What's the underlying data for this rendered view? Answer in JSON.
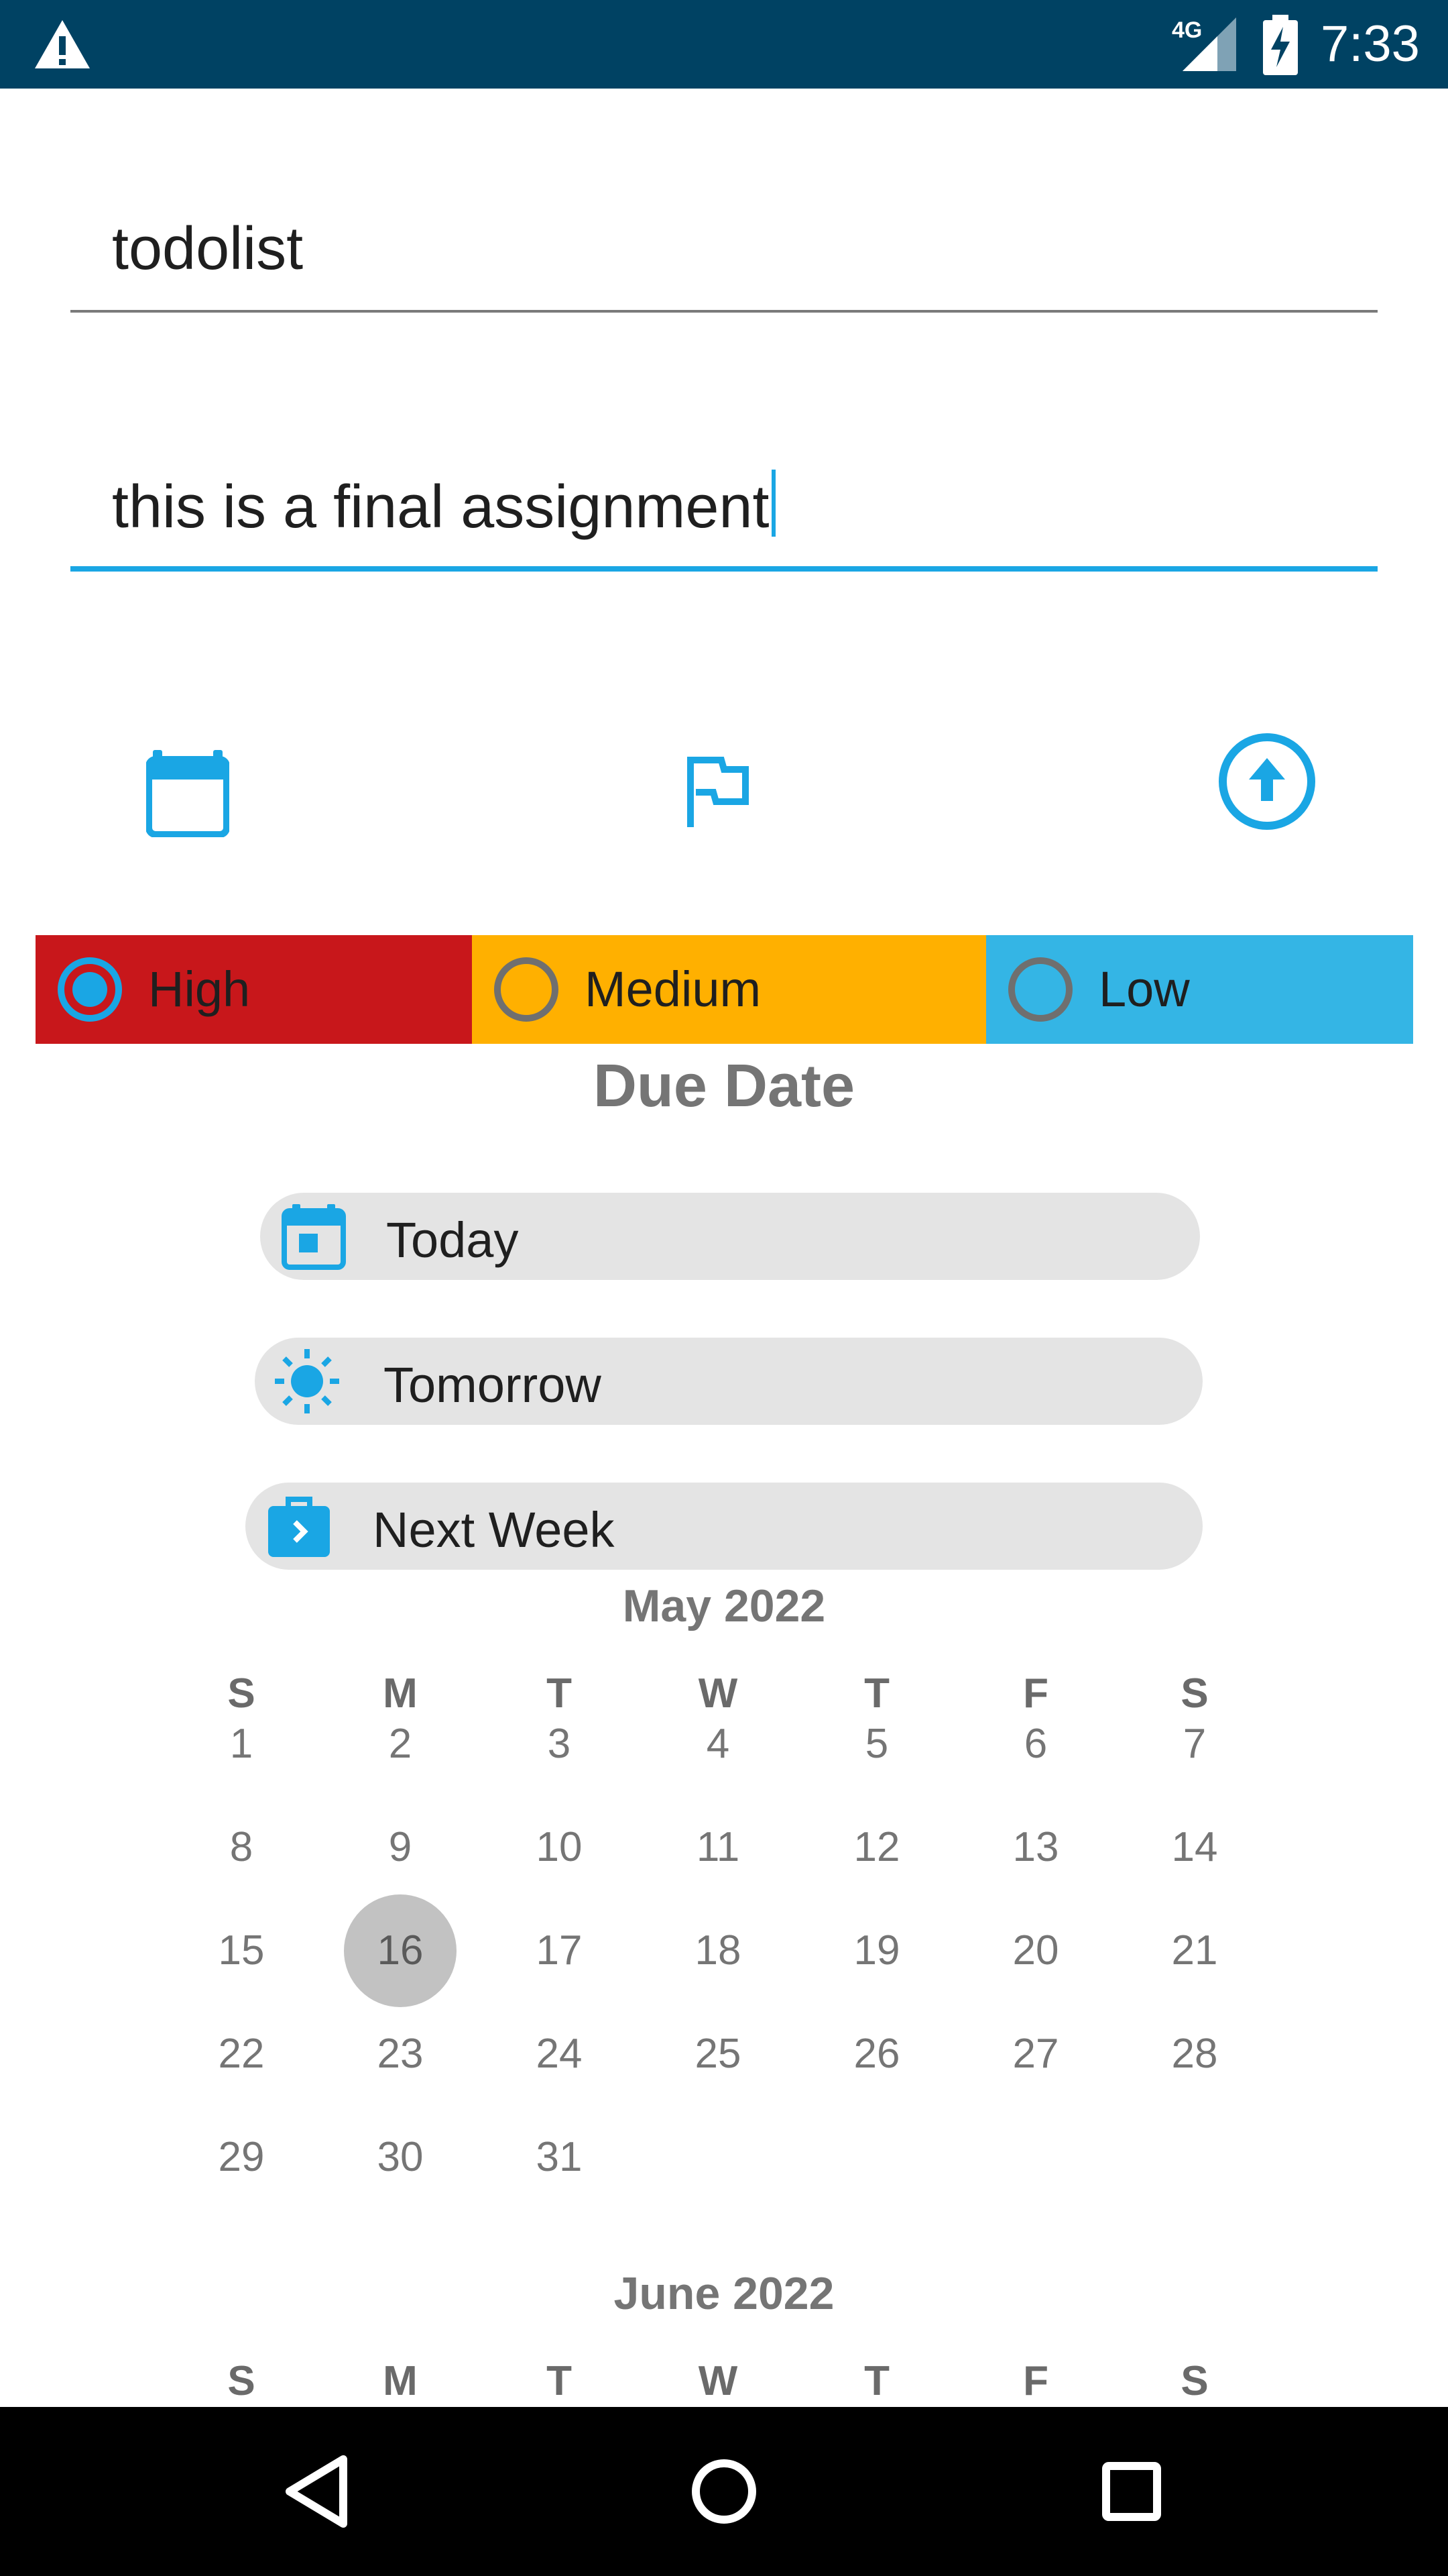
{
  "status_bar": {
    "network": "4G",
    "time": "7:33",
    "color": "#004263"
  },
  "form": {
    "title_value": "todolist",
    "description_value": "this is a final assignment"
  },
  "actions": [
    {
      "icon": "calendar-icon"
    },
    {
      "icon": "flag-icon"
    },
    {
      "icon": "arrow-up-circle-icon"
    }
  ],
  "priorities": [
    {
      "label": "High",
      "color": "#c8171b",
      "selected": true
    },
    {
      "label": "Medium",
      "color": "#ffb000",
      "selected": false
    },
    {
      "label": "Low",
      "color": "#34b5e5",
      "selected": false
    }
  ],
  "due_date": {
    "title": "Due Date",
    "options": [
      {
        "label": "Today",
        "icon": "calendar-today-icon"
      },
      {
        "label": "Tomorrow",
        "icon": "sun-icon"
      },
      {
        "label": "Next Week",
        "icon": "briefcase-arrow-icon"
      }
    ]
  },
  "calendar": {
    "weekday_headers": [
      "S",
      "M",
      "T",
      "W",
      "T",
      "F",
      "S"
    ],
    "months": [
      {
        "title": "May 2022",
        "weeks": [
          [
            "1",
            "2",
            "3",
            "4",
            "5",
            "6",
            "7"
          ],
          [
            "8",
            "9",
            "10",
            "11",
            "12",
            "13",
            "14"
          ],
          [
            "15",
            "16",
            "17",
            "18",
            "19",
            "20",
            "21"
          ],
          [
            "22",
            "23",
            "24",
            "25",
            "26",
            "27",
            "28"
          ],
          [
            "29",
            "30",
            "31",
            "",
            "",
            "",
            ""
          ]
        ],
        "selected_day": "16"
      },
      {
        "title": "June 2022",
        "weeks": []
      }
    ]
  },
  "accent_color": "#1aa6e4"
}
